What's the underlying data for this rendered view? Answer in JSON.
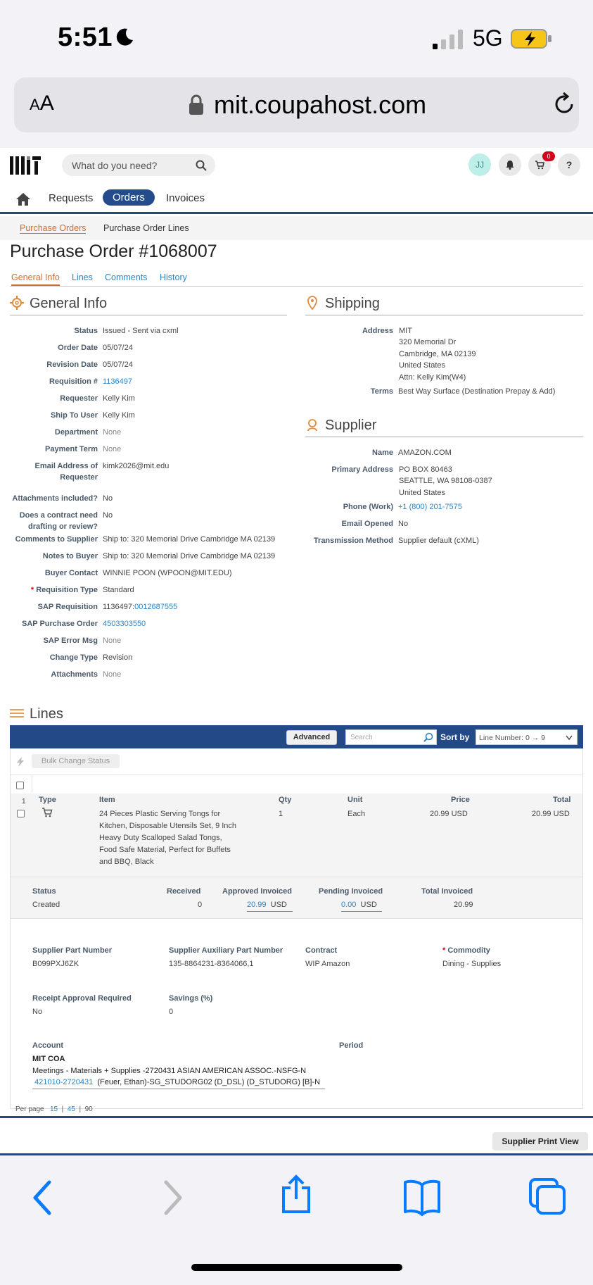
{
  "status_bar": {
    "time": "5:51",
    "network": "5G"
  },
  "browser": {
    "aa_label_small": "A",
    "aa_label_large": "A",
    "url": "mit.coupahost.com"
  },
  "header": {
    "search_placeholder": "What do you need?",
    "avatar_initials": "JJ",
    "cart_count": "0",
    "help": "?"
  },
  "nav": {
    "items": [
      "Requests",
      "Orders",
      "Invoices"
    ],
    "active": "Orders"
  },
  "subnav": {
    "items": [
      "Purchase Orders",
      "Purchase Order Lines"
    ]
  },
  "page_title": "Purchase Order #1068007",
  "tabs": [
    "General Info",
    "Lines",
    "Comments",
    "History"
  ],
  "general_info": {
    "heading": "General Info",
    "fields": [
      {
        "label": "Status",
        "value": "Issued - Sent via cxml"
      },
      {
        "label": "Order Date",
        "value": "05/07/24"
      },
      {
        "label": "Revision Date",
        "value": "05/07/24"
      },
      {
        "label": "Requisition #",
        "value": "1136497"
      },
      {
        "label": "Requester",
        "value": "Kelly Kim"
      },
      {
        "label": "Ship To User",
        "value": "Kelly Kim"
      },
      {
        "label": "Department",
        "value": "None"
      },
      {
        "label": "Payment Term",
        "value": "None"
      },
      {
        "label": "Email Address of",
        "label2": "Requester",
        "value": "kimk2026@mit.edu"
      },
      {
        "label": "Attachments included?",
        "value": "No"
      },
      {
        "label": "Does a contract need",
        "label2": "drafting or review?",
        "value": "No"
      },
      {
        "label": "Comments to Supplier",
        "value": "Ship to: 320 Memorial Drive Cambridge MA 02139"
      },
      {
        "label": "Notes to Buyer",
        "value": "Ship to: 320 Memorial Drive Cambridge MA 02139"
      },
      {
        "label": "Buyer Contact",
        "value": "WINNIE POON (WPOON@MIT.EDU)"
      },
      {
        "label": "Requisition Type",
        "required": "*",
        "value": "Standard"
      },
      {
        "label": "SAP Requisition",
        "value": "1136497:",
        "value_link": "0012687555"
      },
      {
        "label": "SAP Purchase Order",
        "value": "4503303550"
      },
      {
        "label": "SAP Error Msg",
        "value": "None"
      },
      {
        "label": "Change Type",
        "value": "Revision"
      },
      {
        "label": "Attachments",
        "value": "None"
      }
    ]
  },
  "shipping": {
    "heading": "Shipping",
    "address_label": "Address",
    "address": [
      "MIT",
      "320 Memorial Dr",
      "Cambridge, MA 02139",
      "United States",
      "Attn: Kelly Kim(W4)"
    ],
    "terms_label": "Terms",
    "terms": "Best Way Surface (Destination Prepay & Add)"
  },
  "supplier": {
    "heading": "Supplier",
    "name_label": "Name",
    "name": "AMAZON.COM",
    "primary_address_label": "Primary Address",
    "primary_address": [
      "PO BOX 80463",
      "SEATTLE, WA 98108-0387",
      "United States"
    ],
    "phone_label": "Phone (Work)",
    "phone": "+1 (800) 201-7575",
    "email_opened_label": "Email Opened",
    "email_opened": "No",
    "transmission_label": "Transmission Method",
    "transmission": "Supplier default (cXML)"
  },
  "lines": {
    "heading": "Lines",
    "advanced": "Advanced",
    "search_placeholder": "Search",
    "sort_by": "Sort by",
    "sort_value": "Line Number: 0 → 9",
    "bulk_change": "Bulk Change Status",
    "columns": {
      "type": "Type",
      "item": "Item",
      "qty": "Qty",
      "unit": "Unit",
      "price": "Price",
      "total": "Total"
    },
    "line": {
      "number": "1",
      "item_lines": [
        "24 Pieces Plastic Serving Tongs for",
        "Kitchen, Disposable Utensils Set, 9 Inch",
        "Heavy Duty Scalloped Salad Tongs,",
        "Food Safe Material, Perfect for Buffets",
        "and BBQ, Black"
      ],
      "qty": "1",
      "unit": "Each",
      "price": "20.99 USD",
      "total": "20.99 USD",
      "status_label": "Status",
      "status": "Created",
      "received_label": "Received",
      "received": "0",
      "approved_label": "Approved Invoiced",
      "approved": "20.99",
      "approved_ccy": "USD",
      "pending_label": "Pending Invoiced",
      "pending": "0.00",
      "pending_ccy": "USD",
      "total_invoiced_label": "Total Invoiced",
      "total_invoiced": "20.99",
      "spn_label": "Supplier Part Number",
      "spn": "B099PXJ6ZK",
      "sapn_label": "Supplier Auxiliary Part Number",
      "sapn": "135-8864231-8364066,1",
      "contract_label": "Contract",
      "contract": "WIP Amazon",
      "commodity_label": "Commodity",
      "commodity": "Dining - Supplies",
      "receipt_label": "Receipt Approval Required",
      "receipt": "No",
      "savings_label": "Savings (%)",
      "savings": "0",
      "account_label": "Account",
      "period_label": "Period",
      "account_coa": "MIT COA",
      "account_desc": "Meetings - Materials + Supplies -2720431 ASIAN AMERICAN ASSOC.-NSFG-N",
      "account_code_link": "421010-2720431",
      "account_code_rest": "(Feuer, Ethan)-SG_STUDORG02 (D_DSL) (D_STUDORG) [B]-N"
    }
  },
  "per_page": {
    "label": "Per page",
    "options": [
      "15",
      "45",
      "90"
    ]
  },
  "print_view": "Supplier Print View"
}
